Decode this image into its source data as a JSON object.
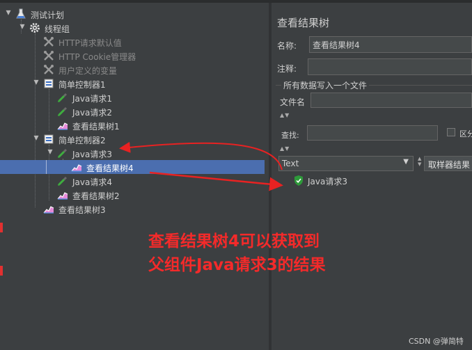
{
  "tree": [
    {
      "id": "plan",
      "label": "测试计划",
      "icon": "flask-icon",
      "level": 0,
      "expanded": true,
      "disabled": false,
      "selected": false
    },
    {
      "id": "threadgroup",
      "label": "线程组",
      "icon": "gear-icon",
      "level": 1,
      "expanded": true,
      "disabled": false,
      "selected": false
    },
    {
      "id": "httpdefaults",
      "label": "HTTP请求默认值",
      "icon": "wrench-icon",
      "level": 2,
      "expanded": null,
      "disabled": true,
      "selected": false
    },
    {
      "id": "cookiemgr",
      "label": "HTTP Cookie管理器",
      "icon": "wrench-icon",
      "level": 2,
      "expanded": null,
      "disabled": true,
      "selected": false
    },
    {
      "id": "uservars",
      "label": "用户定义的变量",
      "icon": "wrench-icon",
      "level": 2,
      "expanded": null,
      "disabled": true,
      "selected": false
    },
    {
      "id": "ctrl1",
      "label": "简单控制器1",
      "icon": "controller-icon",
      "level": 2,
      "expanded": true,
      "disabled": false,
      "selected": false
    },
    {
      "id": "java1",
      "label": "Java请求1",
      "icon": "pipette-icon",
      "level": 3,
      "expanded": null,
      "disabled": false,
      "selected": false
    },
    {
      "id": "java2",
      "label": "Java请求2",
      "icon": "pipette-icon",
      "level": 3,
      "expanded": null,
      "disabled": false,
      "selected": false
    },
    {
      "id": "tree1",
      "label": "查看结果树1",
      "icon": "chart-icon",
      "level": 3,
      "expanded": null,
      "disabled": false,
      "selected": false
    },
    {
      "id": "ctrl2",
      "label": "简单控制器2",
      "icon": "controller-icon",
      "level": 2,
      "expanded": true,
      "disabled": false,
      "selected": false
    },
    {
      "id": "java3",
      "label": "Java请求3",
      "icon": "pipette-icon",
      "level": 3,
      "expanded": true,
      "disabled": false,
      "selected": false
    },
    {
      "id": "tree4",
      "label": "查看结果树4",
      "icon": "chart-icon",
      "level": 4,
      "expanded": null,
      "disabled": false,
      "selected": true
    },
    {
      "id": "java4",
      "label": "Java请求4",
      "icon": "pipette-icon",
      "level": 3,
      "expanded": null,
      "disabled": false,
      "selected": false
    },
    {
      "id": "tree2",
      "label": "查看结果树2",
      "icon": "chart-icon",
      "level": 3,
      "expanded": null,
      "disabled": false,
      "selected": false
    },
    {
      "id": "tree3",
      "label": "查看结果树3",
      "icon": "chart-icon",
      "level": 2,
      "expanded": null,
      "disabled": false,
      "selected": false
    }
  ],
  "panel": {
    "title": "查看结果树",
    "name_label": "名称:",
    "name_value": "查看结果树4",
    "comment_label": "注释:",
    "comment_value": "",
    "file_group": "所有数据写入一个文件",
    "file_label": "文件名",
    "file_value": "",
    "search_label": "查找:",
    "search_value": "",
    "case_label": "区分",
    "renderer": "Text",
    "renderer_tab": "取样器结果",
    "result_item": "Java请求3"
  },
  "annotation": {
    "line1": "查看结果树4可以获取到",
    "line2": "父组件Java请求3的结果"
  },
  "watermark": "CSDN @弹简特",
  "colors": {
    "accent": "#4b6eaf",
    "annotation": "#f42a2a",
    "success": "#2e9a3a"
  }
}
